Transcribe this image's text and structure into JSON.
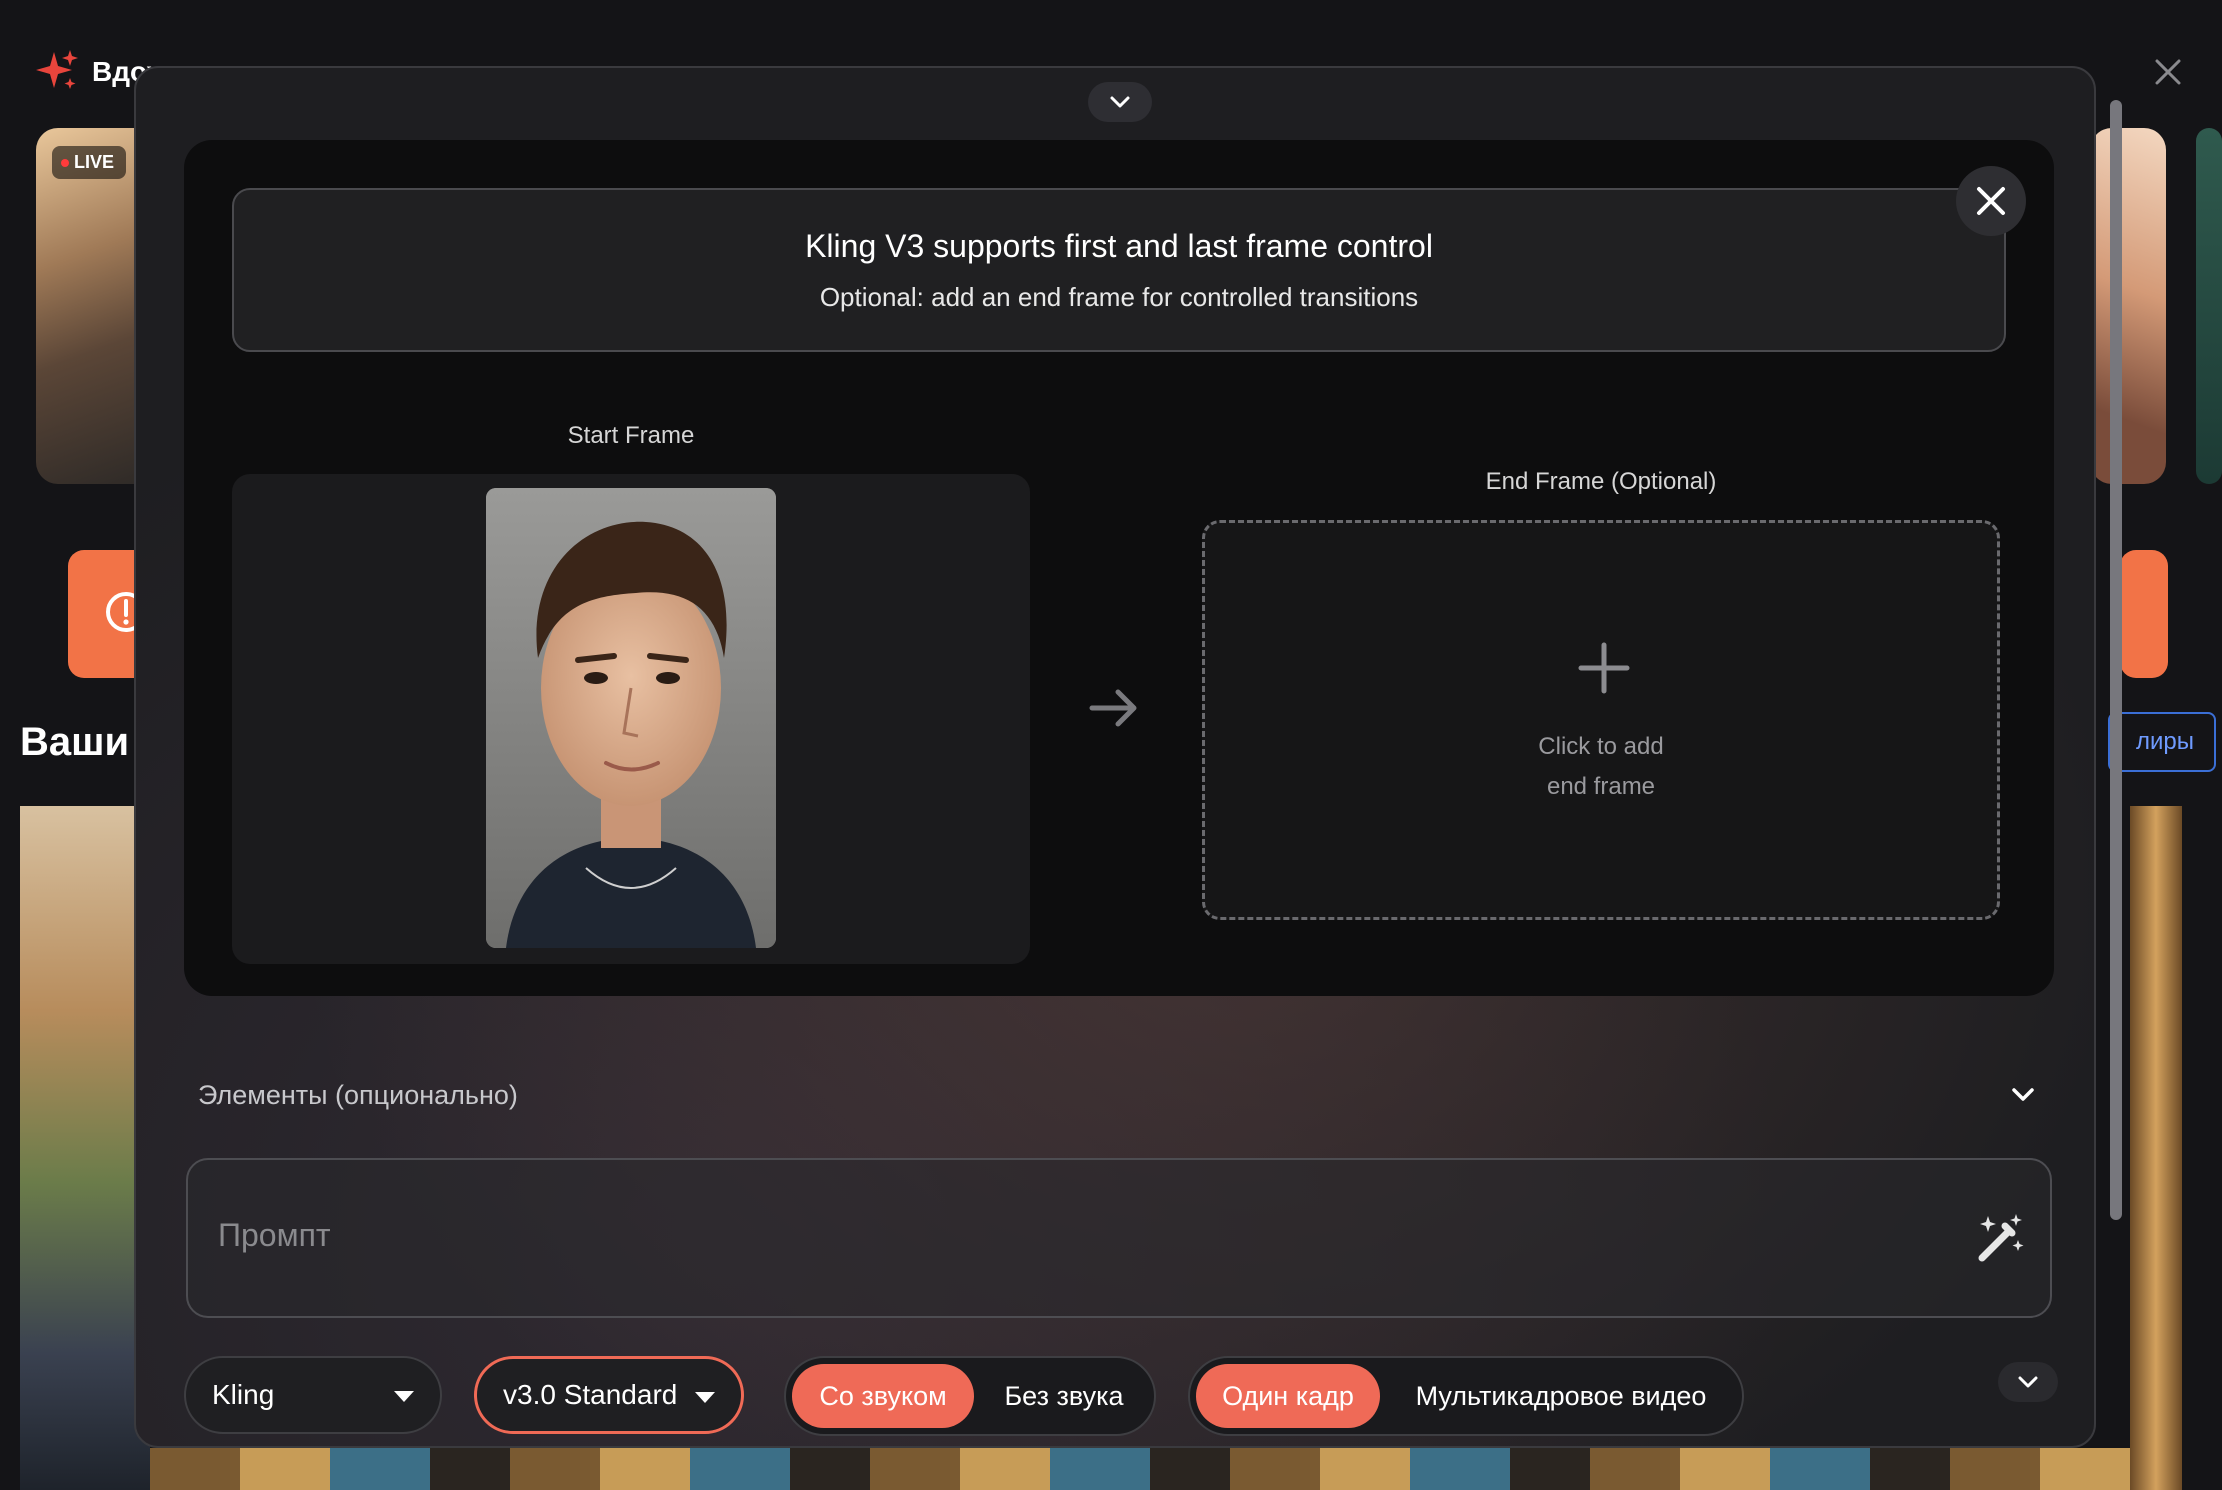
{
  "background": {
    "header_title": "Вдох",
    "live_badge": "LIVE",
    "section_heading": "Ваши",
    "link_button_label": "лиры"
  },
  "banner": {
    "title": "Kling V3 supports first and last frame control",
    "subtitle": "Optional: add an end frame for controlled transitions"
  },
  "frames": {
    "start_label": "Start Frame",
    "end_label": "End Frame (Optional)",
    "end_placeholder_line1": "Click to add",
    "end_placeholder_line2": "end frame"
  },
  "elements": {
    "label": "Элементы (опционально)"
  },
  "prompt": {
    "placeholder": "Промпт",
    "value": ""
  },
  "toolbar": {
    "model": "Kling",
    "version": "v3.0 Standard",
    "audio_options": [
      "Со звуком",
      "Без звука"
    ],
    "audio_selected": "Со звуком",
    "frame_options": [
      "Один кадр",
      "Мультикадровое видео"
    ],
    "frame_selected": "Один кадр"
  },
  "colors": {
    "accent": "#ef6a57",
    "orange_card": "#f27347",
    "link_blue": "#3b6fd6"
  }
}
